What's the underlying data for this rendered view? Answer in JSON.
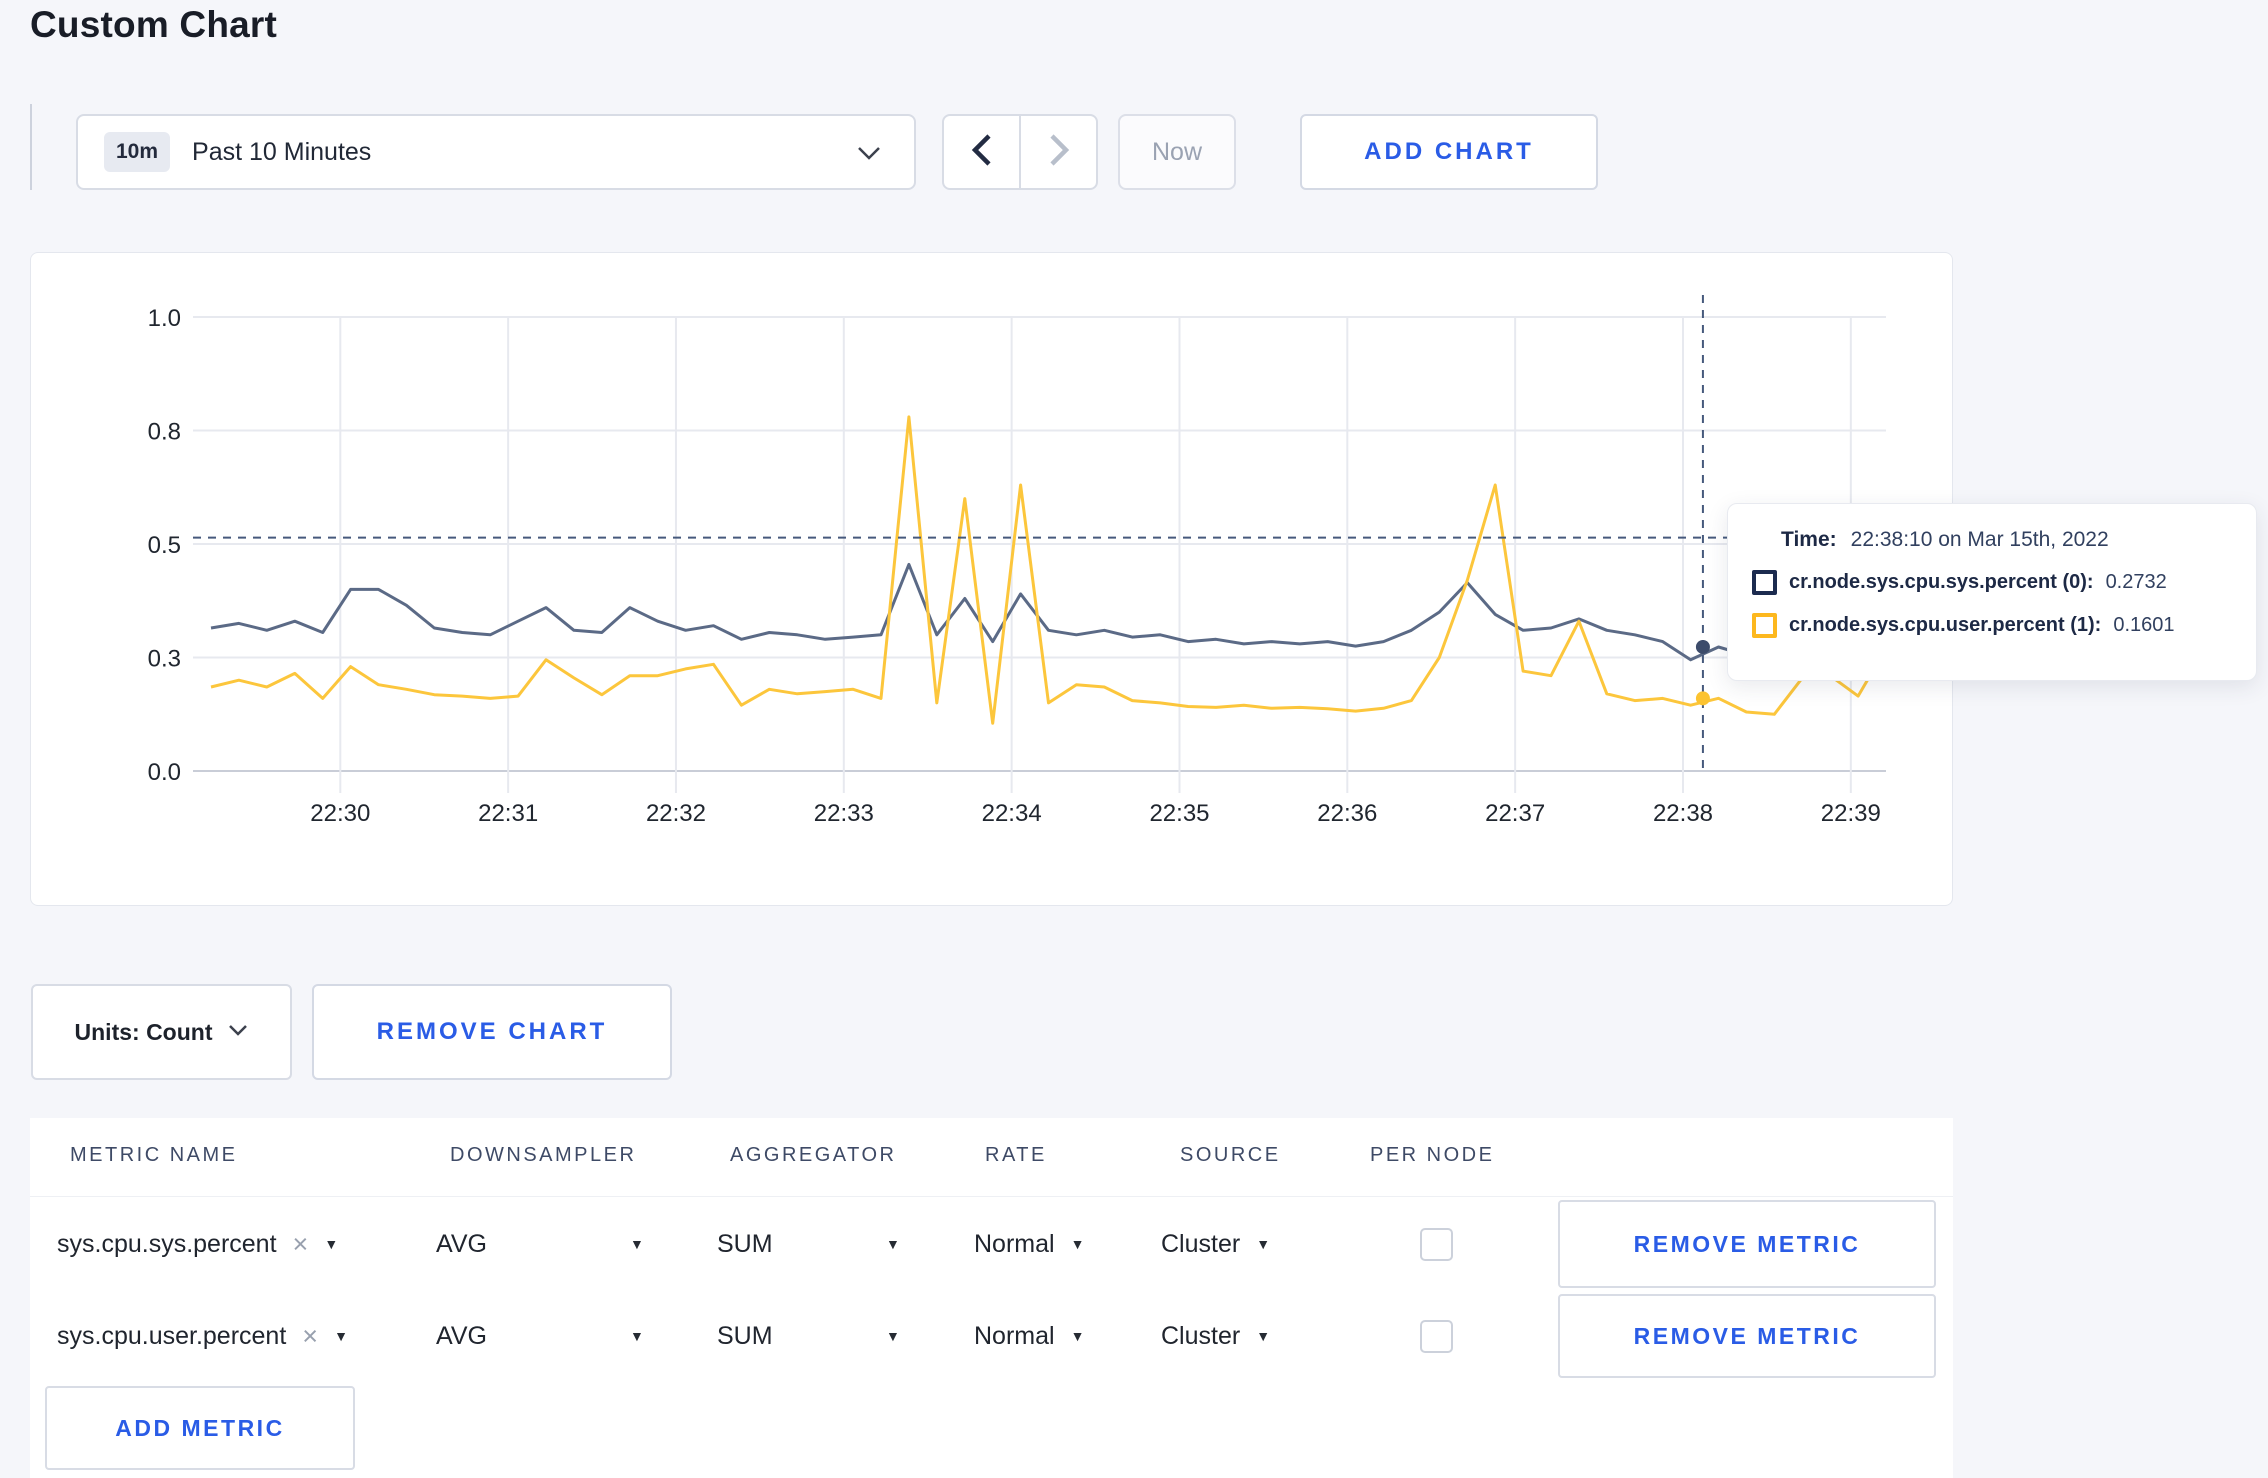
{
  "page": {
    "title": "Custom Chart",
    "accent_blue": "#2a5ce6",
    "background": "#f5f6fa"
  },
  "toolbar": {
    "time_badge": "10m",
    "time_label": "Past 10 Minutes",
    "now_label": "Now",
    "add_chart_label": "ADD CHART"
  },
  "glyphs": {
    "caret": "▼",
    "clear": "×"
  },
  "chart_data": {
    "type": "line",
    "title": "",
    "xlabel": "",
    "ylabel": "",
    "ylim": [
      0,
      1.0
    ],
    "grid": true,
    "y_axis": {
      "ticks": [
        {
          "value": 0,
          "label": "0.0"
        },
        {
          "value": 0.25,
          "label": "0.3"
        },
        {
          "value": 0.5,
          "label": "0.5"
        },
        {
          "value": 0.75,
          "label": "0.8"
        },
        {
          "value": 1.0,
          "label": "1.0"
        }
      ]
    },
    "x_axis": {
      "tick_labels": [
        "22:30",
        "22:31",
        "22:32",
        "22:33",
        "22:34",
        "22:35",
        "22:36",
        "22:37",
        "22:38",
        "22:39"
      ],
      "first_tick_frac": 0.0772,
      "tick_step_frac": 0.1002
    },
    "series": [
      {
        "name": "cr.node.sys.cpu.sys.percent",
        "color": "#5b6a86",
        "dot_color": "#3d4c6b",
        "values": [
          0.315,
          0.325,
          0.31,
          0.33,
          0.305,
          0.4,
          0.4,
          0.365,
          0.315,
          0.305,
          0.3,
          0.33,
          0.36,
          0.31,
          0.305,
          0.36,
          0.33,
          0.31,
          0.32,
          0.29,
          0.305,
          0.3,
          0.29,
          0.295,
          0.3,
          0.455,
          0.3,
          0.38,
          0.285,
          0.39,
          0.31,
          0.3,
          0.31,
          0.295,
          0.3,
          0.285,
          0.29,
          0.28,
          0.285,
          0.28,
          0.285,
          0.275,
          0.285,
          0.31,
          0.35,
          0.415,
          0.345,
          0.31,
          0.315,
          0.335,
          0.31,
          0.3,
          0.285,
          0.245,
          0.2732,
          0.255,
          0.27,
          0.3,
          0.295,
          0.3,
          0.305
        ]
      },
      {
        "name": "cr.node.sys.cpu.user.percent",
        "color": "#fcc63c",
        "dot_color": "#fcc330",
        "values": [
          0.185,
          0.2,
          0.185,
          0.215,
          0.16,
          0.23,
          0.19,
          0.18,
          0.168,
          0.165,
          0.16,
          0.165,
          0.245,
          0.205,
          0.168,
          0.21,
          0.21,
          0.225,
          0.235,
          0.145,
          0.18,
          0.17,
          0.175,
          0.18,
          0.16,
          0.78,
          0.15,
          0.6,
          0.105,
          0.63,
          0.15,
          0.19,
          0.185,
          0.155,
          0.15,
          0.142,
          0.14,
          0.145,
          0.138,
          0.14,
          0.137,
          0.132,
          0.138,
          0.155,
          0.25,
          0.42,
          0.63,
          0.22,
          0.21,
          0.33,
          0.17,
          0.155,
          0.16,
          0.145,
          0.1601,
          0.13,
          0.125,
          0.205,
          0.21,
          0.165,
          0.27
        ]
      }
    ],
    "hover": {
      "x_frac": 0.8907,
      "hline_value": 0.514,
      "points": [
        {
          "series": 0,
          "value": 0.2732
        },
        {
          "series": 1,
          "value": 0.1601
        }
      ]
    },
    "legend_position": "tooltip"
  },
  "tooltip": {
    "time_label": "Time:",
    "time_value": "22:38:10 on Mar 15th, 2022",
    "rows": [
      {
        "name": "cr.node.sys.cpu.sys.percent (0):",
        "value": "0.2732",
        "color": "#1c2b4f"
      },
      {
        "name": "cr.node.sys.cpu.user.percent (1):",
        "value": "0.1601",
        "color": "#fdb81e"
      }
    ]
  },
  "chart_footer": {
    "units_label": "Units: Count",
    "remove_chart_label": "REMOVE CHART"
  },
  "metrics_table": {
    "headers": [
      "METRIC NAME",
      "DOWNSAMPLER",
      "AGGREGATOR",
      "RATE",
      "SOURCE",
      "PER NODE"
    ],
    "rows": [
      {
        "metric": "sys.cpu.sys.percent",
        "downsampler": "AVG",
        "aggregator": "SUM",
        "rate": "Normal",
        "source": "Cluster",
        "per_node": false,
        "remove_label": "REMOVE METRIC"
      },
      {
        "metric": "sys.cpu.user.percent",
        "downsampler": "AVG",
        "aggregator": "SUM",
        "rate": "Normal",
        "source": "Cluster",
        "per_node": false,
        "remove_label": "REMOVE METRIC"
      }
    ],
    "add_metric_label": "ADD METRIC"
  }
}
